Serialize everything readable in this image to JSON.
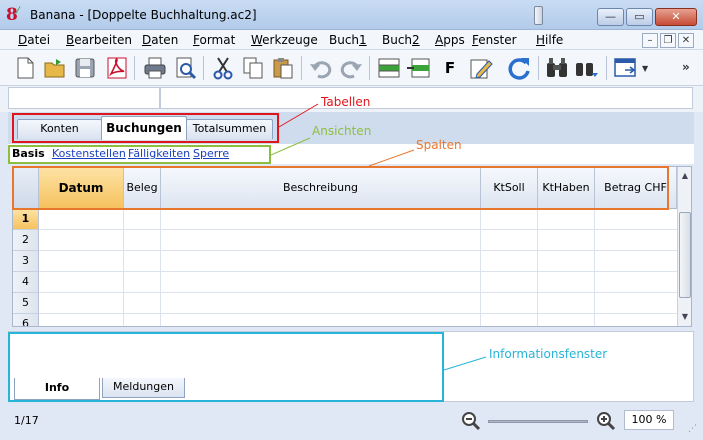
{
  "window": {
    "title": "Banana - [Doppelte Buchhaltung.ac2]",
    "min_glyph": "—",
    "max_glyph": "▭",
    "close_glyph": "✕"
  },
  "menu": {
    "items": [
      "Datei",
      "Bearbeiten",
      "Daten",
      "Format",
      "Werkzeuge",
      "Buch1",
      "Buch2",
      "Apps",
      "Fenster",
      "Hilfe"
    ],
    "mdi_min": "–",
    "mdi_restore": "❐",
    "mdi_close": "✕"
  },
  "toolbar": {
    "icons": [
      "new-file-icon",
      "open-folder-icon",
      "save-icon",
      "pdf-icon",
      "print-icon",
      "print-preview-icon",
      "cut-icon",
      "copy-icon",
      "paste-icon",
      "undo-icon",
      "redo-icon",
      "insert-row-icon",
      "delete-row-icon",
      "bold-icon",
      "edit-icon",
      "recalculate-icon",
      "find-icon",
      "find-next-icon",
      "window-icon"
    ],
    "bold_glyph": "F",
    "more_glyph": "»"
  },
  "tabs": {
    "items": [
      "Konten",
      "Buchungen",
      "Totalsummen"
    ],
    "active": "Buchungen"
  },
  "views": {
    "items": [
      "Basis",
      "Kostenstellen",
      "Fälligkeiten",
      "Sperre"
    ],
    "active": "Basis"
  },
  "table": {
    "columns": [
      "Datum",
      "Beleg",
      "Beschreibung",
      "KtSoll",
      "KtHaben",
      "Betrag CHF"
    ],
    "selected_column": "Datum",
    "row_numbers": [
      "1",
      "2",
      "3",
      "4",
      "5",
      "6"
    ],
    "selected_row": "1"
  },
  "info_panel": {
    "tabs": [
      "Info",
      "Meldungen"
    ],
    "active": "Info"
  },
  "status": {
    "position": "1/17",
    "zoom": "100 %",
    "zoom_fraction": 0.5
  },
  "annotations": {
    "tabellen": "Tabellen",
    "ansichten": "Ansichten",
    "spalten": "Spalten",
    "informationsfenster": "Informationsfenster",
    "colors": {
      "tabellen": "#e0161c",
      "ansichten": "#8cbf3f",
      "spalten": "#e8772e",
      "informationsfenster": "#27b4d9"
    }
  }
}
